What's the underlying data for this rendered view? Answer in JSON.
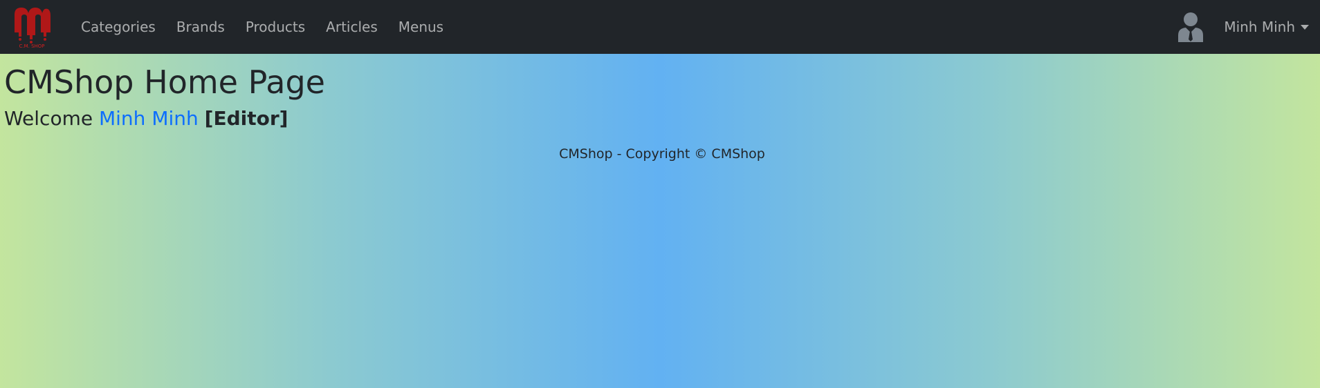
{
  "app": {
    "logo_name": "CM SHOP logo",
    "logo_text": "C.M. SHOP"
  },
  "nav": {
    "items": [
      {
        "label": "Categories"
      },
      {
        "label": "Brands"
      },
      {
        "label": "Products"
      },
      {
        "label": "Articles"
      },
      {
        "label": "Menus"
      }
    ]
  },
  "user": {
    "avatar_icon": "user-avatar-icon",
    "display_name": "Minh Minh"
  },
  "main": {
    "title": "CMShop Home Page",
    "welcome_prefix": "Welcome",
    "welcome_user": "Minh Minh",
    "role": "[Editor]"
  },
  "footer": {
    "text": "CMShop - Copyright © CMShop"
  },
  "colors": {
    "navbar_bg": "#212529",
    "link_blue": "#0d6efd",
    "logo_red": "#b01818"
  }
}
